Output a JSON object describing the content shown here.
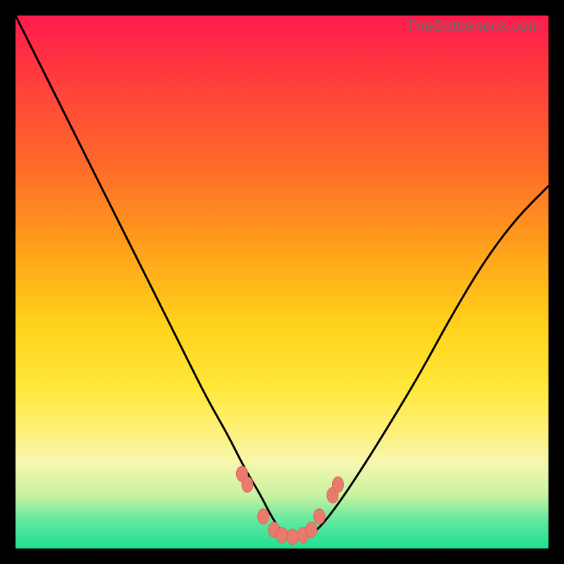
{
  "watermark": "TheBottleneck.com",
  "colors": {
    "frame": "#000000",
    "gradient_top": "#ff1a4b",
    "gradient_bottom": "#1fe08f",
    "curve": "#000000",
    "marker": "#e97b6e"
  },
  "chart_data": {
    "type": "line",
    "title": "",
    "xlabel": "",
    "ylabel": "",
    "xlim": [
      0,
      100
    ],
    "ylim": [
      0,
      100
    ],
    "series": [
      {
        "name": "bottleneck-curve",
        "x": [
          0,
          4,
          8,
          12,
          16,
          20,
          24,
          28,
          32,
          36,
          40,
          43,
          46,
          48,
          50,
          52,
          54,
          56,
          58,
          61,
          65,
          70,
          76,
          82,
          88,
          94,
          100
        ],
        "y": [
          100,
          92,
          84,
          76,
          68,
          60,
          52,
          44,
          36,
          28,
          21,
          15,
          10,
          6,
          3,
          2,
          2,
          3,
          5,
          9,
          15,
          23,
          33,
          44,
          54,
          62,
          68
        ]
      }
    ],
    "markers": [
      {
        "x": 42.5,
        "y": 14
      },
      {
        "x": 43.5,
        "y": 12
      },
      {
        "x": 46.5,
        "y": 6
      },
      {
        "x": 48.5,
        "y": 3.5
      },
      {
        "x": 50.0,
        "y": 2.5
      },
      {
        "x": 52.0,
        "y": 2.2
      },
      {
        "x": 54.0,
        "y": 2.5
      },
      {
        "x": 55.5,
        "y": 3.5
      },
      {
        "x": 57.0,
        "y": 6
      },
      {
        "x": 59.5,
        "y": 10
      },
      {
        "x": 60.5,
        "y": 12
      }
    ]
  }
}
